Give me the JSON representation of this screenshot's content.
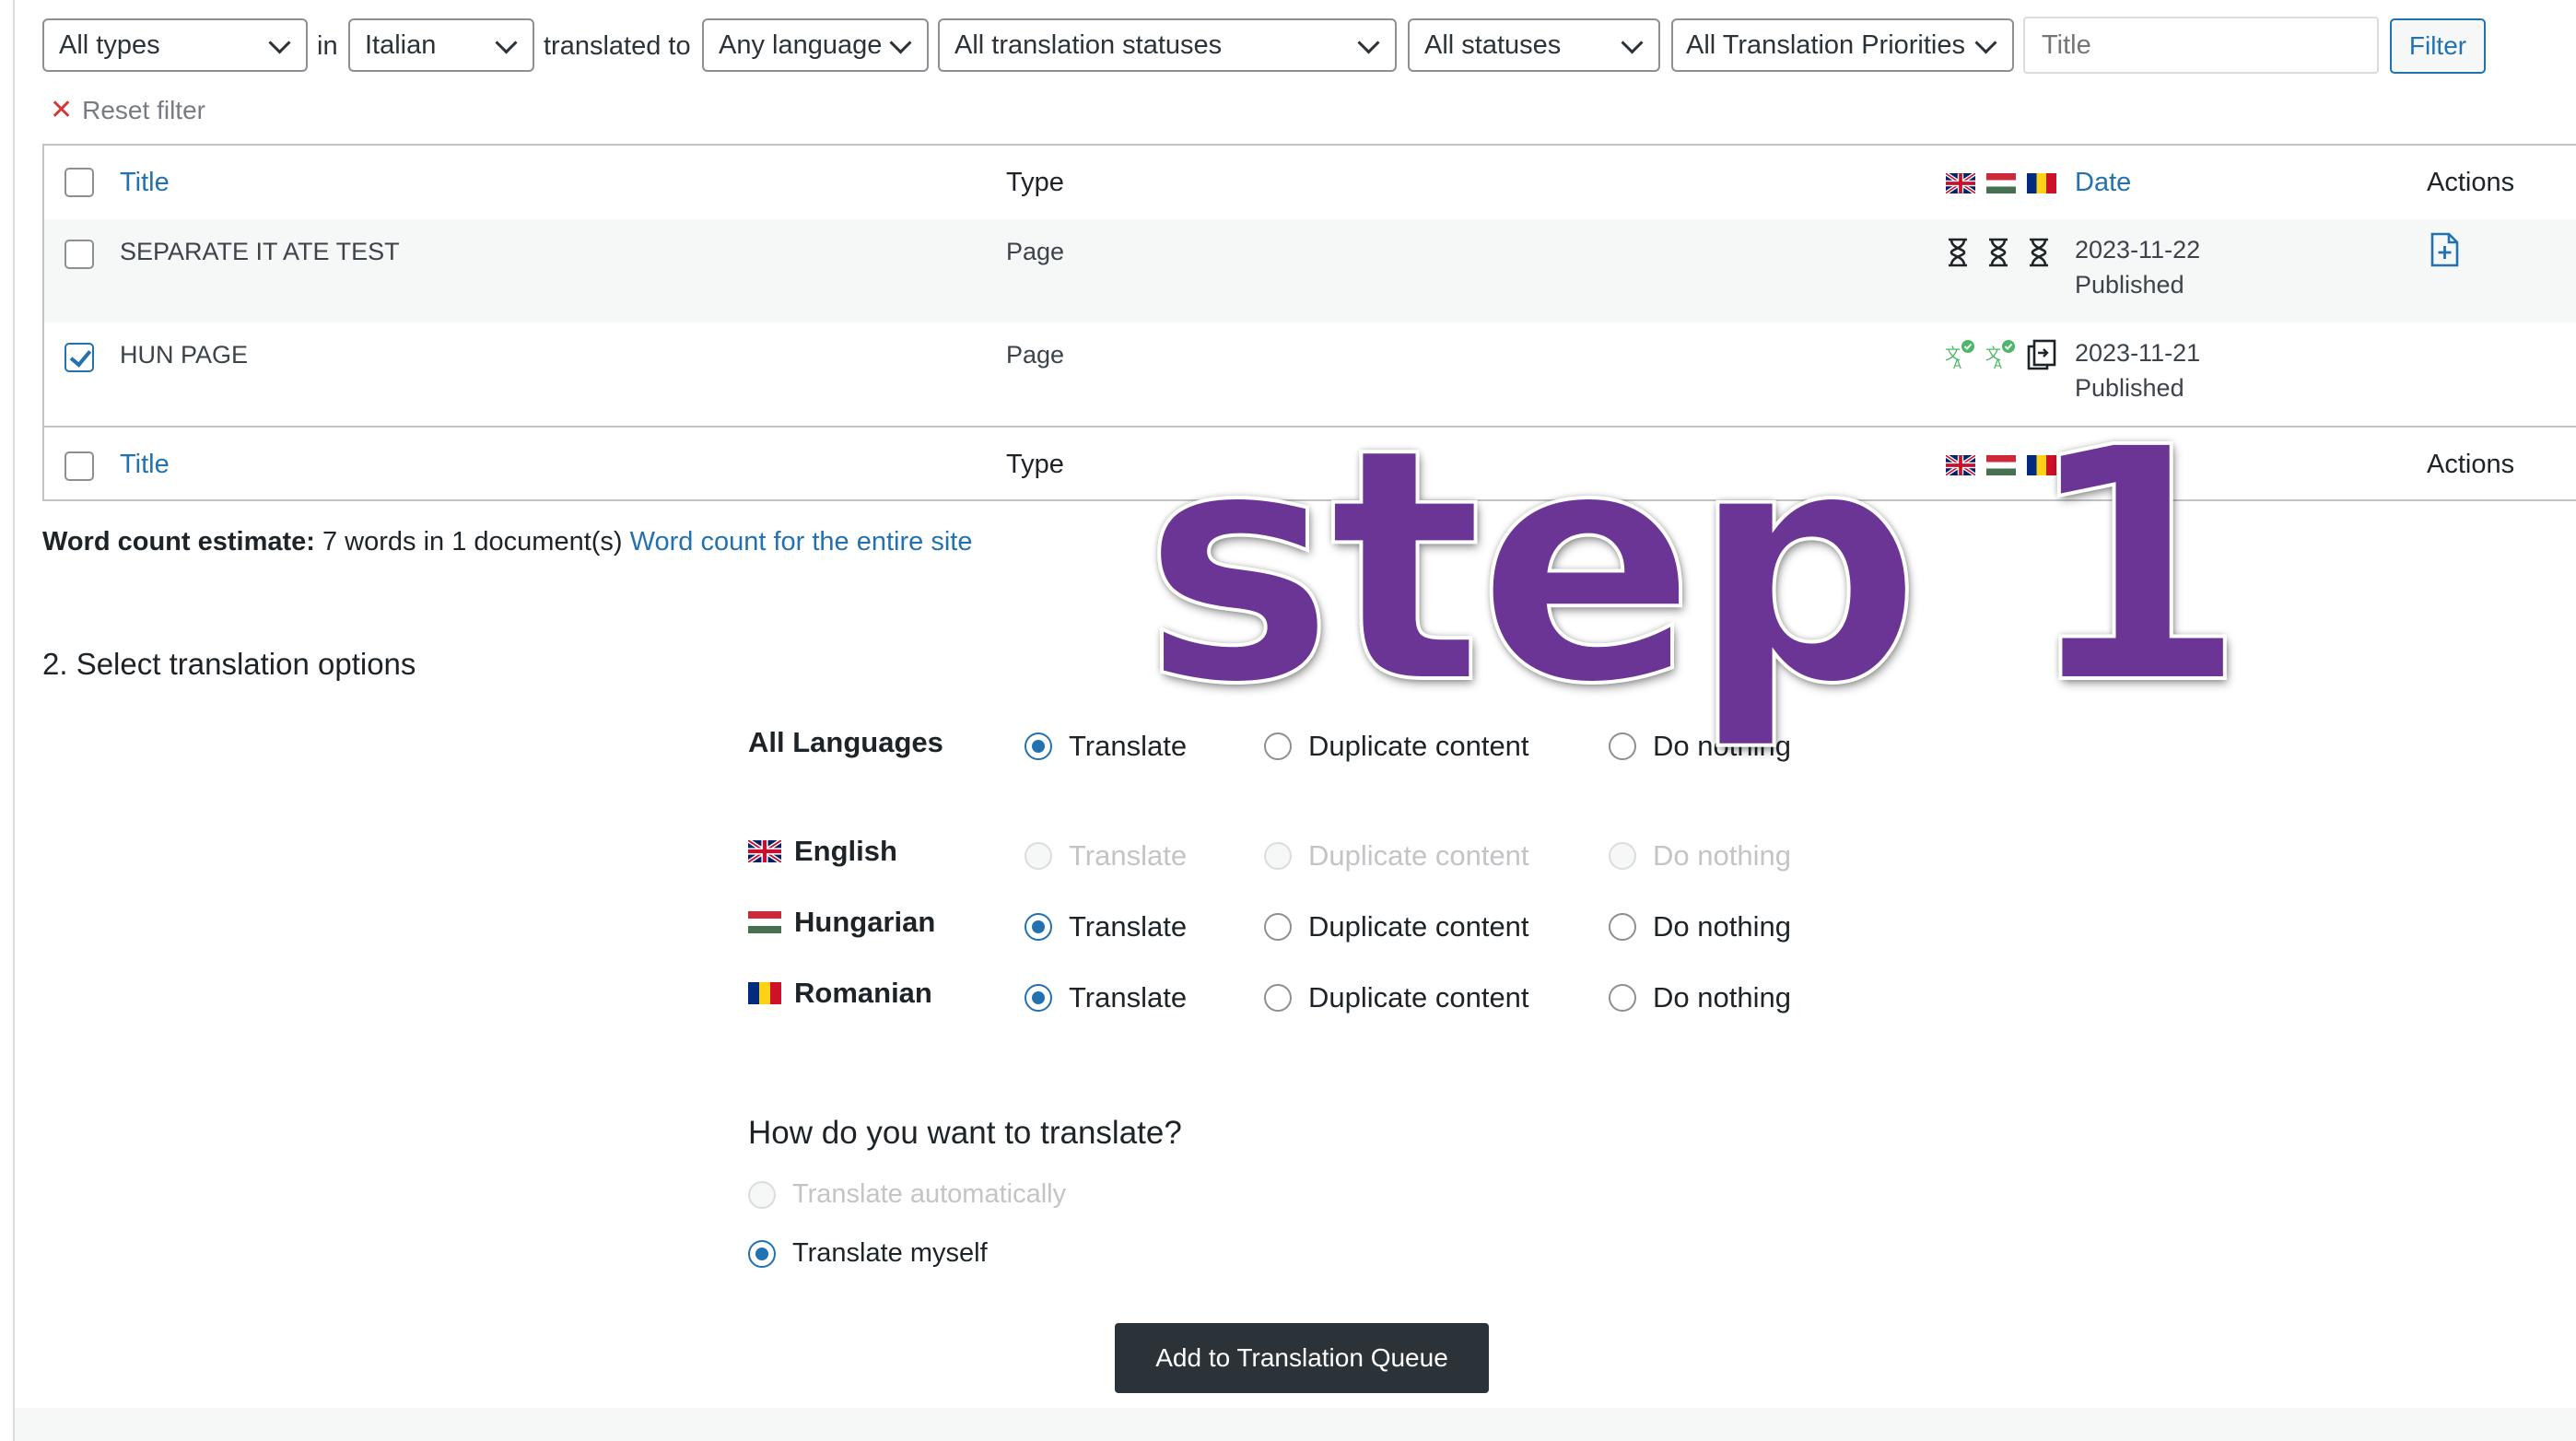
{
  "filters": {
    "types": "All types",
    "in_word": "in",
    "source_language": "Italian",
    "translated_to_word": "translated to",
    "target_language": "Any language",
    "translation_status": "All translation statuses",
    "status": "All statuses",
    "priority": "All Translation Priorities",
    "title_placeholder": "Title",
    "filter_button": "Filter",
    "reset_filter": "Reset filter"
  },
  "table": {
    "columns": {
      "title": "Title",
      "type": "Type",
      "date": "Date",
      "actions": "Actions"
    },
    "flag_icons": [
      "flag-en-icon",
      "flag-hu-icon",
      "flag-ro-icon"
    ],
    "rows": [
      {
        "title": "SEPARATE IT ATE TEST",
        "type": "Page",
        "date": "2023-11-22",
        "status": "Published",
        "checked": false,
        "statuses": [
          "hourglass-icon",
          "hourglass-icon",
          "hourglass-icon"
        ],
        "action_icon": "add-document-icon"
      },
      {
        "title": "HUN PAGE",
        "type": "Page",
        "date": "2023-11-21",
        "status": "Published",
        "checked": true,
        "statuses": [
          "translated-icon",
          "translated-icon",
          "duplicate-icon"
        ],
        "action_icon": ""
      }
    ]
  },
  "word_count": {
    "label": "Word count estimate:",
    "value": "7 words in 1 document(s)",
    "link": "Word count for the entire site"
  },
  "options": {
    "section_title": "2. Select translation options",
    "choices": [
      "Translate",
      "Duplicate content",
      "Do nothing"
    ],
    "all_languages": {
      "label": "All Languages",
      "selected": "Translate"
    },
    "languages": [
      {
        "name": "English",
        "flag": "flag-en-icon",
        "selected": "",
        "disabled": true
      },
      {
        "name": "Hungarian",
        "flag": "flag-hu-icon",
        "selected": "Translate",
        "disabled": false
      },
      {
        "name": "Romanian",
        "flag": "flag-ro-icon",
        "selected": "Translate",
        "disabled": false
      }
    ]
  },
  "how": {
    "title": "How do you want to translate?",
    "auto": "Translate automatically",
    "auto_disabled": true,
    "myself": "Translate myself",
    "selected": "myself"
  },
  "queue_button": "Add to Translation Queue",
  "overlay_text": "step 1",
  "colors": {
    "accent": "#2271b1",
    "overlay": "#6b3596",
    "button_dark": "#2c3338",
    "translated_green": "#4ab866"
  }
}
